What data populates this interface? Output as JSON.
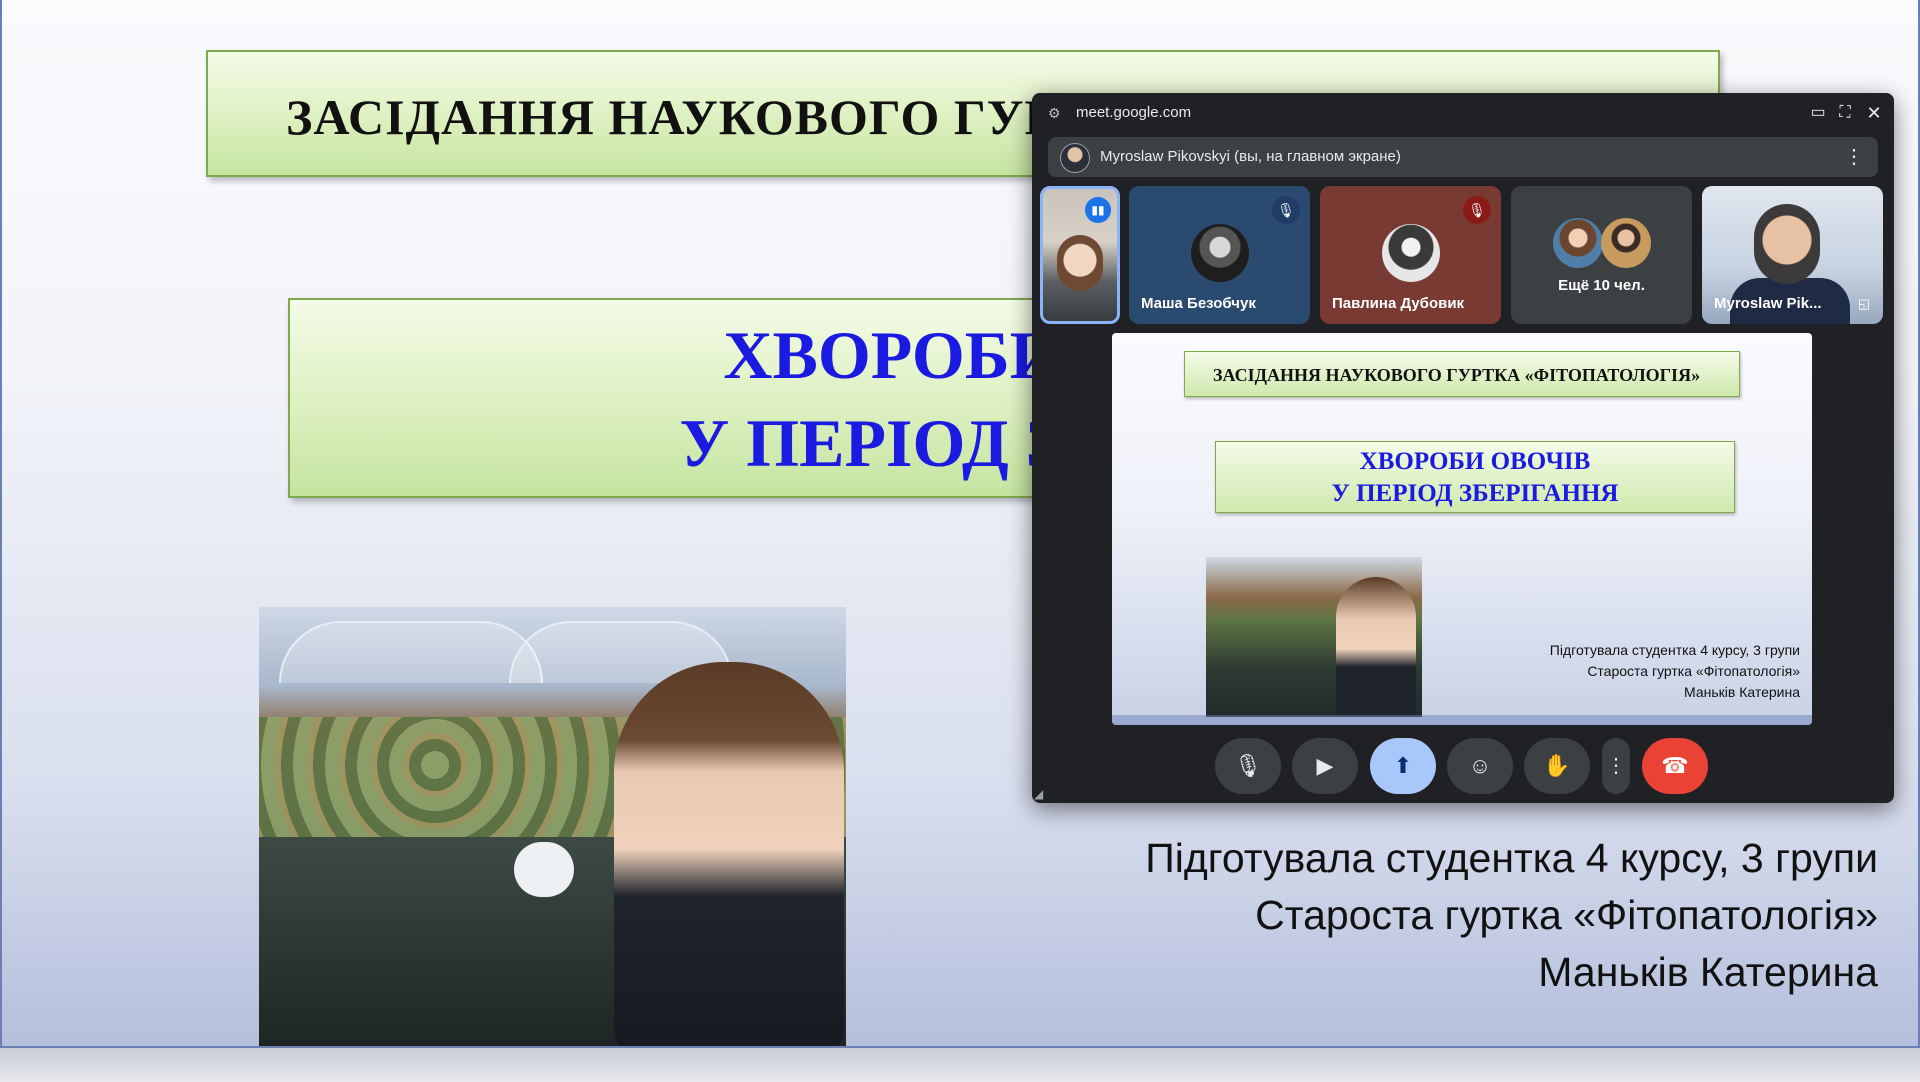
{
  "slide": {
    "title_top": "ЗАСІДАННЯ НАУКОВОГО ГУРТ",
    "title_main_line1": "ХВОРОБИ",
    "title_main_line2": "У ПЕРІОД ЗБ",
    "credits": [
      "Підготувала студентка 4 курсу, 3 групи",
      "Староста гуртка «Фітопатологія»",
      "Маньків Катерина"
    ]
  },
  "meet": {
    "url": "meet.google.com",
    "presenter": "Myroslaw Pikovskyi (вы, на главном экране)",
    "participants": {
      "masha": "Маша Безобчук",
      "pavlina": "Павлина Дубовик",
      "more": "Ещё 10 чел.",
      "myroslaw": "Myroslaw Pik..."
    },
    "shared_slide": {
      "title_top": "ЗАСІДАННЯ НАУКОВОГО ГУРТКА «ФІТОПАТОЛОГІЯ»",
      "title_line1": "ХВОРОБИ ОВОЧІВ",
      "title_line2": "У ПЕРІОД ЗБЕРІГАННЯ",
      "credits": [
        "Підготувала студентка 4 курсу, 3 групи",
        "Староста гуртка «Фітопатологія»",
        "Маньків Катерина"
      ]
    },
    "icons": {
      "site_info": "tune-icon",
      "back_to_tab": "picture-in-picture-icon",
      "expand": "expand-icon",
      "close": "close-icon",
      "mic": "mic-icon",
      "camera": "camera-icon",
      "present": "present-screen-icon",
      "emoji": "emoji-icon",
      "hand": "raise-hand-icon",
      "more": "more-vert-icon",
      "end_call": "end-call-icon"
    },
    "colors": {
      "background": "#202124",
      "present_active": "#a8c7fa",
      "end_call": "#ea4335",
      "mute_badge_red": "#8b1a16",
      "speaking_badge": "#1a73e8"
    }
  }
}
